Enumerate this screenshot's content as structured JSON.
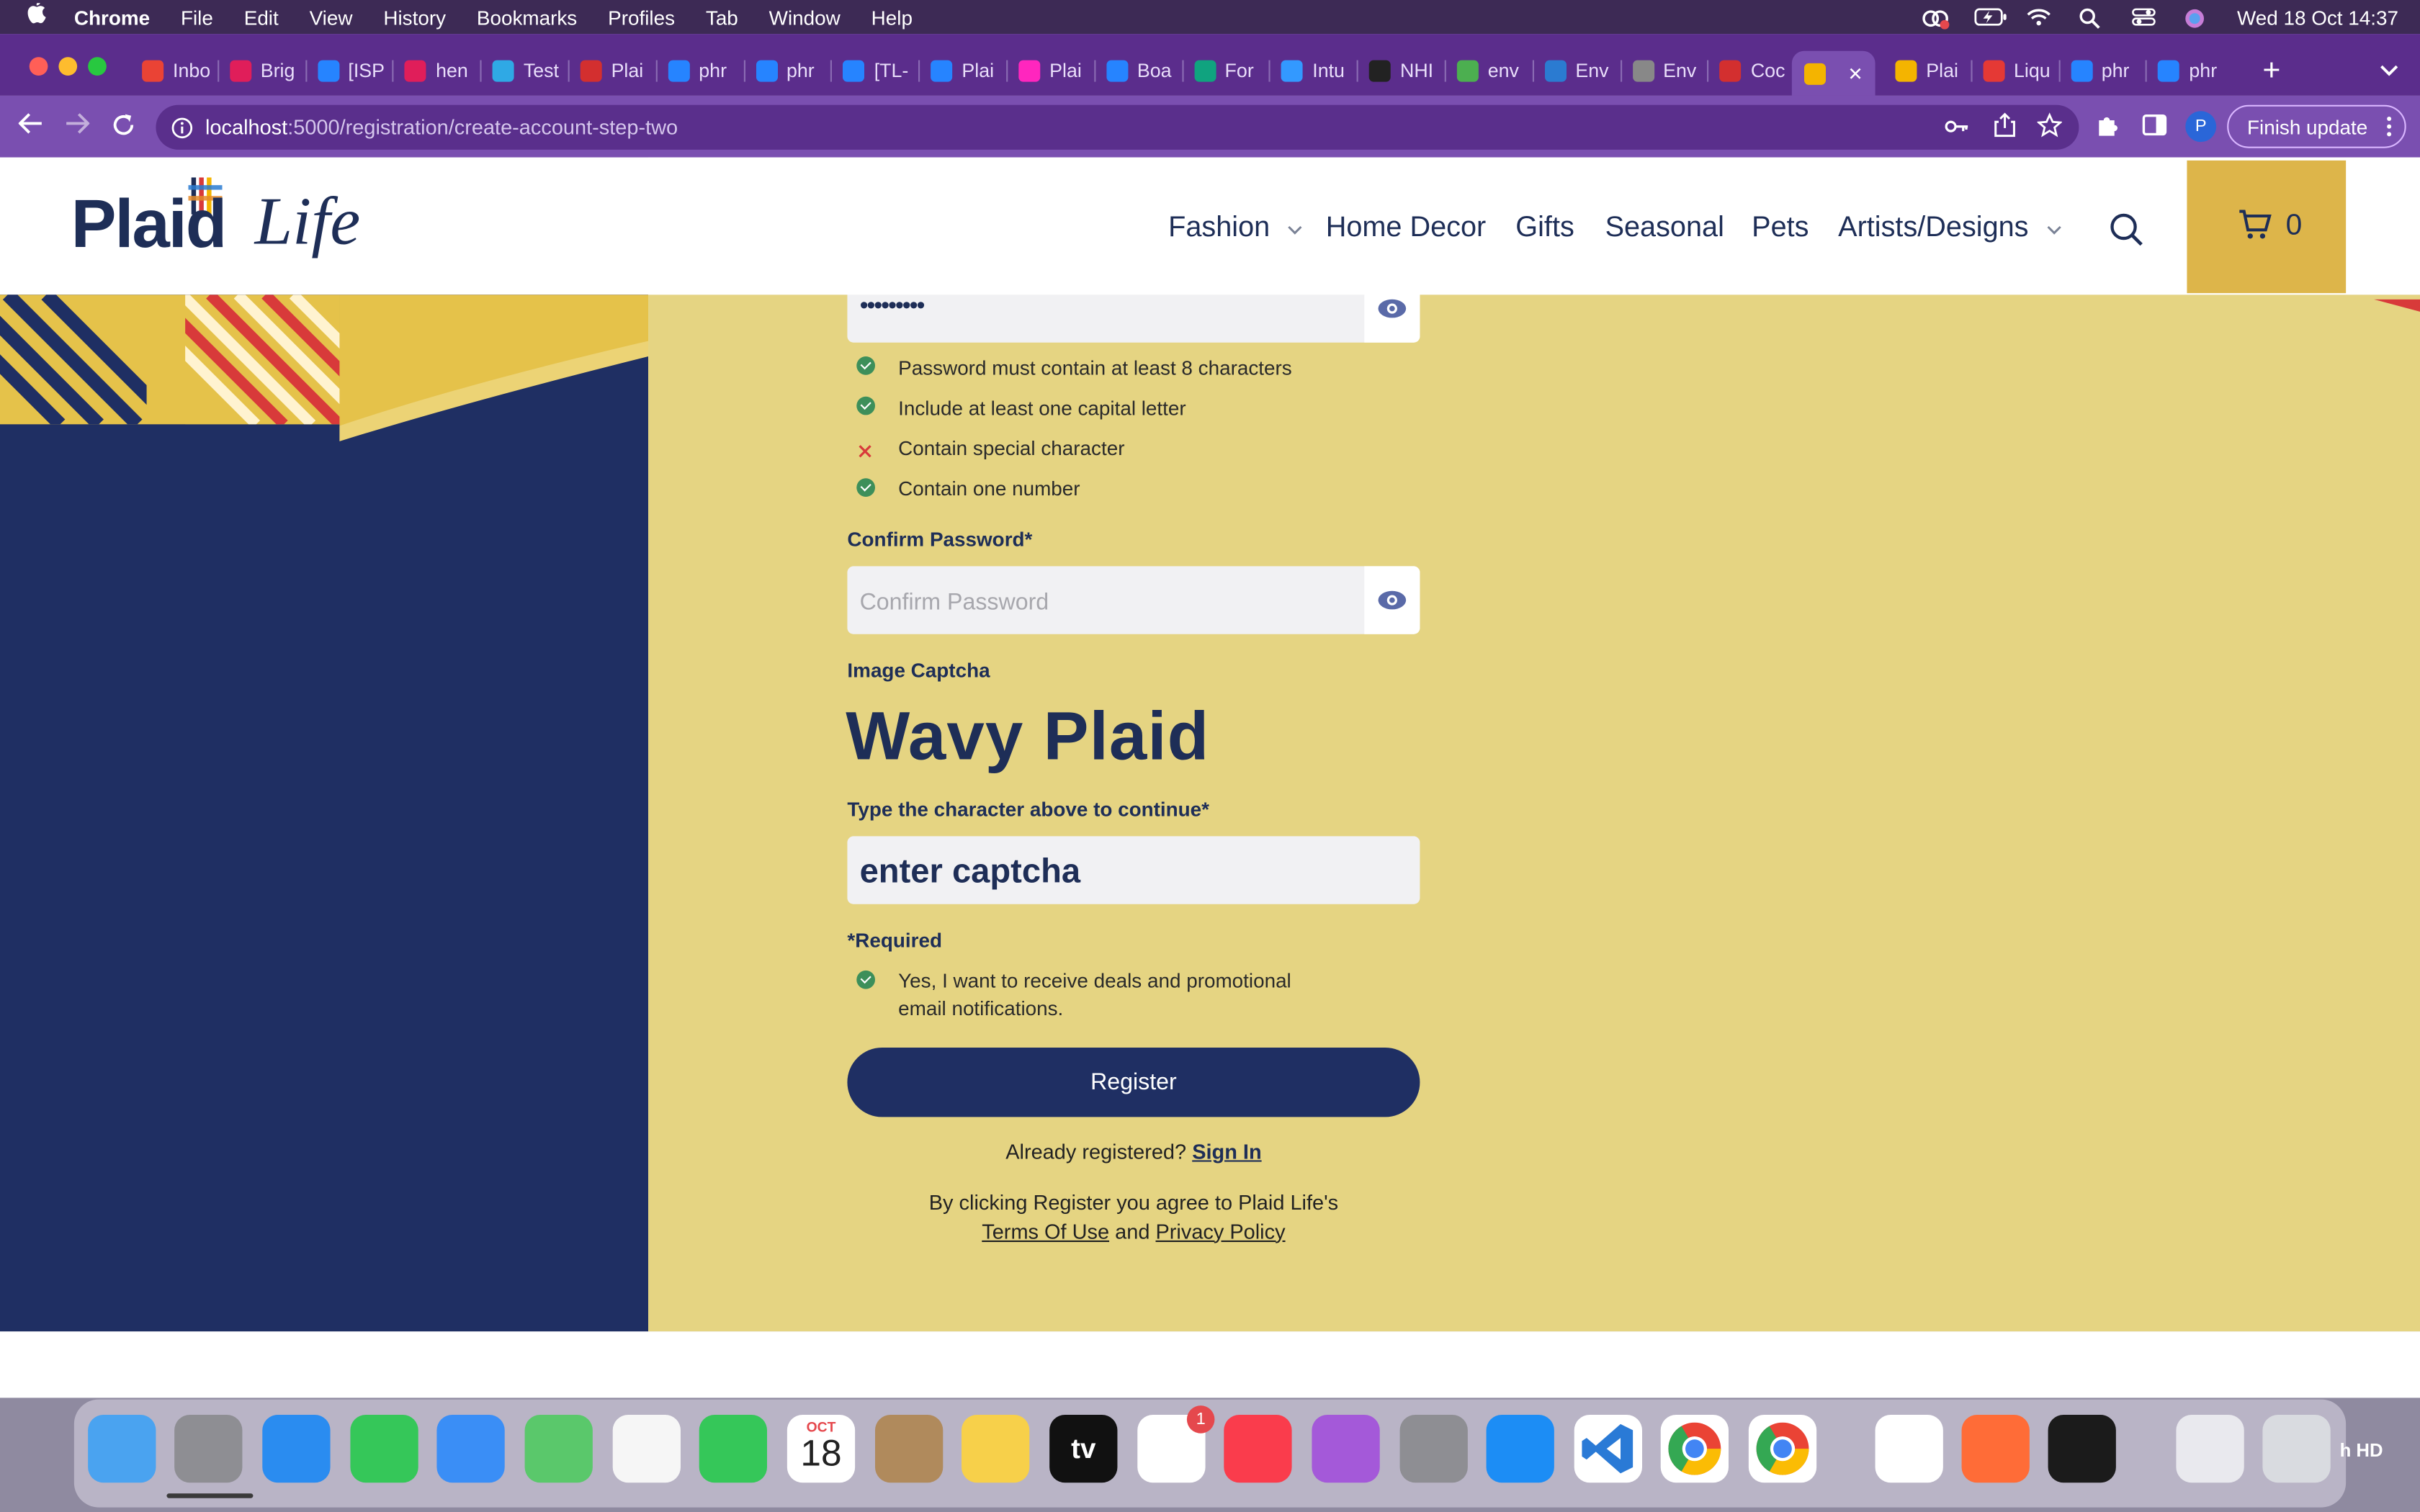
{
  "menubar": {
    "app": "Chrome",
    "items": [
      "File",
      "Edit",
      "View",
      "History",
      "Bookmarks",
      "Profiles",
      "Tab",
      "Window",
      "Help"
    ],
    "datetime": "Wed 18 Oct  14:37"
  },
  "tabs": [
    {
      "label": "Inbo",
      "color": "#ea4335"
    },
    {
      "label": "Brig",
      "color": "#e01e5a"
    },
    {
      "label": "[ISP",
      "color": "#2684ff"
    },
    {
      "label": "hen",
      "color": "#e01e5a"
    },
    {
      "label": "Test",
      "color": "#2fa9e5"
    },
    {
      "label": "Plai",
      "color": "#d32f2f"
    },
    {
      "label": "phr",
      "color": "#2684ff"
    },
    {
      "label": "phr",
      "color": "#2684ff"
    },
    {
      "label": "[TL-",
      "color": "#2684ff"
    },
    {
      "label": "Plai",
      "color": "#2684ff"
    },
    {
      "label": "Plai",
      "color": "#ff26be"
    },
    {
      "label": "Boa",
      "color": "#2684ff"
    },
    {
      "label": "For",
      "color": "#10a37f"
    },
    {
      "label": "Intu",
      "color": "#3399ff"
    },
    {
      "label": "NHI",
      "color": "#222222"
    },
    {
      "label": "env",
      "color": "#4caf50"
    },
    {
      "label": "Env",
      "color": "#2b7bd1"
    },
    {
      "label": "Env",
      "color": "#888888"
    },
    {
      "label": "Coc",
      "color": "#d32f2f"
    },
    {
      "label": "",
      "color": "#f4b400",
      "active": true
    },
    {
      "label": "Plai",
      "color": "#f4b400"
    },
    {
      "label": "Liqu",
      "color": "#e53935"
    },
    {
      "label": "phr",
      "color": "#2684ff"
    },
    {
      "label": "phr",
      "color": "#2684ff"
    }
  ],
  "address": {
    "host": "localhost",
    "path": ":5000/registration/create-account-step-two"
  },
  "browser": {
    "finish_update": "Finish update",
    "profile_initial": "P"
  },
  "site": {
    "logo_plaid": "Plaid",
    "logo_life": "Life",
    "nav": [
      {
        "label": "Fashion",
        "dropdown": true
      },
      {
        "label": "Home Decor",
        "dropdown": false
      },
      {
        "label": "Gifts",
        "dropdown": false
      },
      {
        "label": "Seasonal",
        "dropdown": false
      },
      {
        "label": "Pets",
        "dropdown": false
      },
      {
        "label": "Artists/Designs",
        "dropdown": true
      }
    ],
    "cart_count": "0"
  },
  "form": {
    "password_value": "•••••••••",
    "password_rules": [
      {
        "text": "Password must contain at least 8 characters",
        "met": true
      },
      {
        "text": "Include at least one capital letter",
        "met": true
      },
      {
        "text": "Contain special character",
        "met": false
      },
      {
        "text": "Contain one number",
        "met": true
      }
    ],
    "confirm_label": "Confirm Password*",
    "confirm_placeholder": "Confirm Password",
    "captcha_label": "Image Captcha",
    "captcha_text": "Wavy Plaid",
    "captcha_input_label": "Type the character above to continue*",
    "captcha_placeholder": "enter captcha",
    "required_note": "*Required",
    "optin_text_1": "Yes, I want to receive deals and promotional",
    "optin_text_2": "email notifications.",
    "optin_checked": true,
    "register_label": "Register",
    "already_text": "Already registered?",
    "sign_in": "Sign In",
    "terms_prefix": "By clicking Register you agree to Plaid Life's",
    "terms_link": "Terms Of Use",
    "and_text": "and",
    "privacy_link": "Privacy Policy"
  },
  "dock": {
    "calendar_month": "OCT",
    "calendar_day": "18",
    "reminders_badge": "1",
    "tv_label": "tv",
    "hd_label": "h HD"
  }
}
